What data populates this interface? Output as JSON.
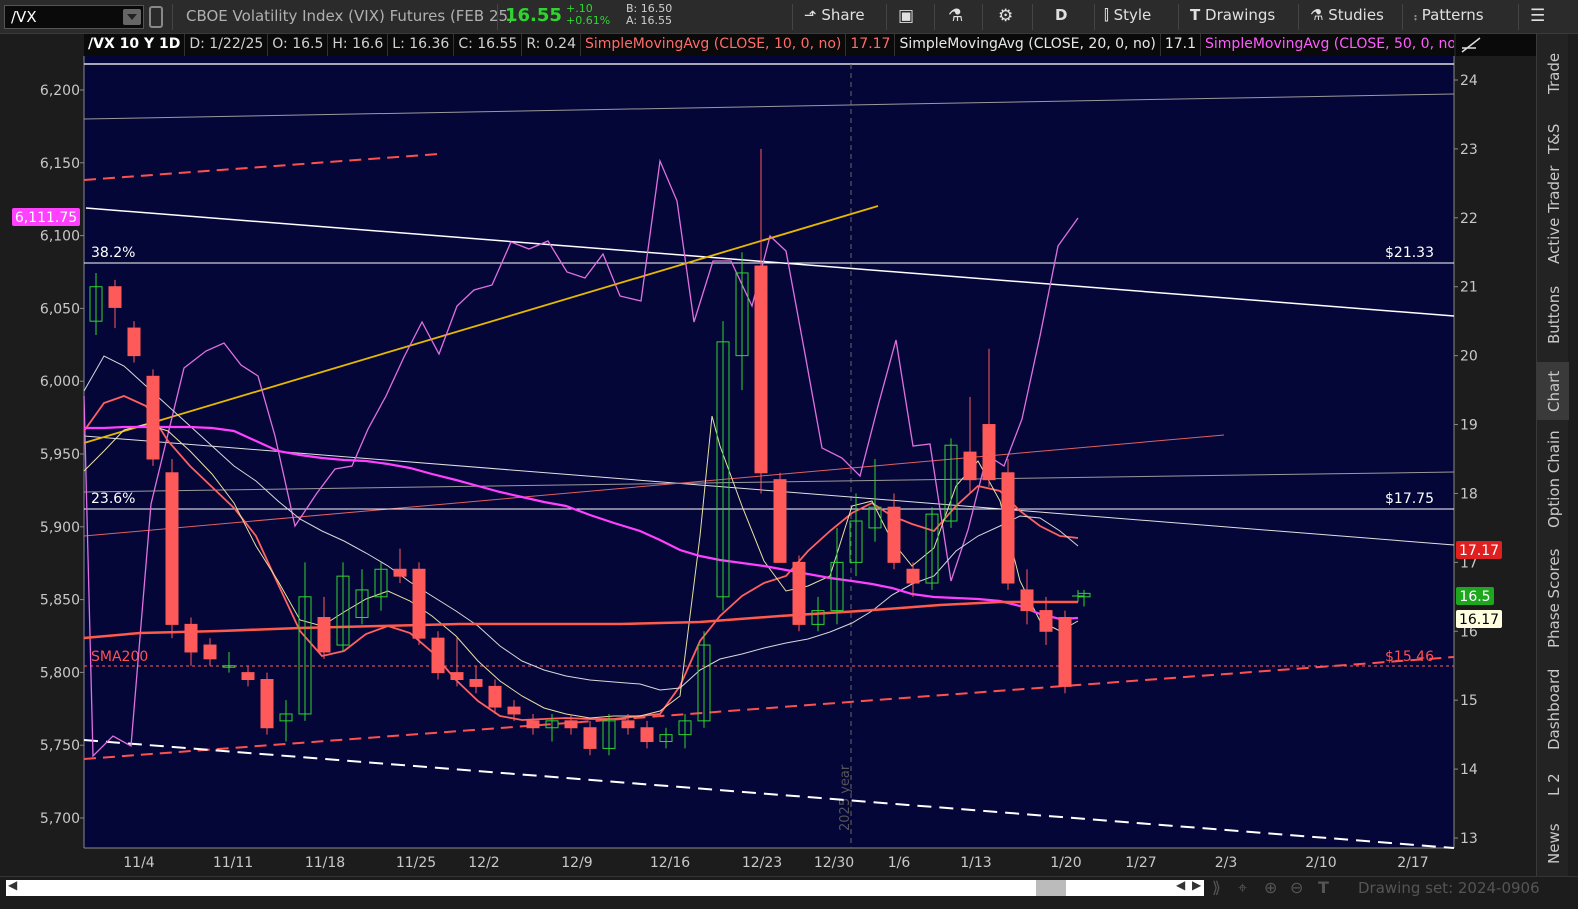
{
  "toolbar": {
    "symbol": "/VX",
    "description": "CBOE Volatility Index (VIX) Futures (FEB 25)",
    "last": "16.55",
    "change": "+.10",
    "change_pct": "+0.61%",
    "bid": "B: 16.50",
    "ask": "A: 16.55",
    "share_label": "Share",
    "aggregation": "D",
    "style_label": "Style",
    "drawings_label": "Drawings",
    "studies_label": "Studies",
    "patterns_label": "Patterns"
  },
  "header": {
    "symbol_period": "/VX 10 Y 1D",
    "date": "D: 1/22/25",
    "open": "O: 16.5",
    "high": "H: 16.6",
    "low": "L: 16.36",
    "close": "C: 16.55",
    "range": "R: 0.24",
    "sma10_label": "SimpleMovingAvg (CLOSE, 10, 0, no)",
    "sma10_value": "17.17",
    "sma20_label": "SimpleMovingAvg (CLOSE, 20, 0, no)",
    "sma20_value": "17.1",
    "sma50_label": "SimpleMovingAvg (CLOSE, 50, 0, no)",
    "more": "..."
  },
  "chart": {
    "left_axis_labels": [
      "6,200",
      "6,150",
      "6,100",
      "6,050",
      "6,000",
      "5,950",
      "5,900",
      "5,850",
      "5,800",
      "5,750",
      "5,700"
    ],
    "right_axis_labels": [
      "24",
      "23",
      "22",
      "21",
      "20",
      "19",
      "18",
      "17",
      "16",
      "15",
      "14",
      "13"
    ],
    "x_labels": [
      "11/4",
      "11/11",
      "11/18",
      "11/25",
      "12/2",
      "12/9",
      "12/16",
      "12/23",
      "12/30",
      "1/6",
      "1/13",
      "1/20",
      "1/27",
      "2/3",
      "2/10",
      "2/17"
    ],
    "left_price_tag": "6,111.75",
    "fib_382": "38.2%",
    "fib_236": "23.6%",
    "fib_382_value": "$21.33",
    "fib_236_value": "$17.75",
    "sma200_label": "SMA200",
    "sma200_value": "$15.46",
    "tag_sma10": "17.17",
    "tag_last": "16.5",
    "tag_sma50": "16.17",
    "year_label": "2025 year",
    "colors": {
      "background": "#050638",
      "up": "#2fd52f",
      "down": "#ff5a5a",
      "sma10": "#ff6060",
      "sma50": "#ff40ff",
      "spx": "#e070e0",
      "trend_yellow": "#e6b800"
    }
  },
  "candles": [
    {
      "d": "10/31",
      "o": 20.5,
      "h": 21.2,
      "l": 20.3,
      "c": 21.0
    },
    {
      "d": "11/1",
      "o": 21.0,
      "h": 21.1,
      "l": 20.4,
      "c": 20.7
    },
    {
      "d": "11/4",
      "o": 20.4,
      "h": 20.5,
      "l": 19.9,
      "c": 20.0
    },
    {
      "d": "11/5",
      "o": 19.7,
      "h": 19.8,
      "l": 18.4,
      "c": 18.5
    },
    {
      "d": "11/6",
      "o": 18.3,
      "h": 18.5,
      "l": 15.9,
      "c": 16.1
    },
    {
      "d": "11/7",
      "o": 16.1,
      "h": 16.2,
      "l": 15.5,
      "c": 15.7
    },
    {
      "d": "11/8",
      "o": 15.8,
      "h": 15.9,
      "l": 15.5,
      "c": 15.6
    },
    {
      "d": "11/11",
      "o": 15.5,
      "h": 15.7,
      "l": 15.4,
      "c": 15.5
    },
    {
      "d": "11/12",
      "o": 15.4,
      "h": 15.5,
      "l": 15.2,
      "c": 15.3
    },
    {
      "d": "11/13",
      "o": 15.3,
      "h": 15.4,
      "l": 14.5,
      "c": 14.6
    },
    {
      "d": "11/14",
      "o": 14.7,
      "h": 15.0,
      "l": 14.4,
      "c": 14.8
    },
    {
      "d": "11/15",
      "o": 14.8,
      "h": 17.0,
      "l": 14.7,
      "c": 16.5
    },
    {
      "d": "11/18",
      "o": 16.2,
      "h": 16.5,
      "l": 15.6,
      "c": 15.7
    },
    {
      "d": "11/19",
      "o": 15.8,
      "h": 17.0,
      "l": 15.7,
      "c": 16.8
    },
    {
      "d": "11/20",
      "o": 16.2,
      "h": 16.9,
      "l": 16.1,
      "c": 16.6
    },
    {
      "d": "11/21",
      "o": 16.5,
      "h": 17.0,
      "l": 16.3,
      "c": 16.9
    },
    {
      "d": "11/22",
      "o": 16.9,
      "h": 17.2,
      "l": 16.7,
      "c": 16.8
    },
    {
      "d": "11/25",
      "o": 16.9,
      "h": 17.0,
      "l": 15.8,
      "c": 15.9
    },
    {
      "d": "11/26",
      "o": 15.9,
      "h": 16.0,
      "l": 15.3,
      "c": 15.4
    },
    {
      "d": "11/27",
      "o": 15.4,
      "h": 15.9,
      "l": 15.2,
      "c": 15.3
    },
    {
      "d": "11/29",
      "o": 15.3,
      "h": 15.5,
      "l": 15.1,
      "c": 15.2
    },
    {
      "d": "12/2",
      "o": 15.2,
      "h": 15.3,
      "l": 14.8,
      "c": 14.9
    },
    {
      "d": "12/3",
      "o": 14.9,
      "h": 15.0,
      "l": 14.7,
      "c": 14.8
    },
    {
      "d": "12/4",
      "o": 14.7,
      "h": 14.8,
      "l": 14.5,
      "c": 14.6
    },
    {
      "d": "12/5",
      "o": 14.6,
      "h": 14.8,
      "l": 14.4,
      "c": 14.7
    },
    {
      "d": "12/6",
      "o": 14.7,
      "h": 14.8,
      "l": 14.5,
      "c": 14.6
    },
    {
      "d": "12/9",
      "o": 14.6,
      "h": 14.7,
      "l": 14.2,
      "c": 14.3
    },
    {
      "d": "12/10",
      "o": 14.3,
      "h": 14.8,
      "l": 14.2,
      "c": 14.7
    },
    {
      "d": "12/11",
      "o": 14.7,
      "h": 14.8,
      "l": 14.5,
      "c": 14.6
    },
    {
      "d": "12/12",
      "o": 14.6,
      "h": 14.7,
      "l": 14.3,
      "c": 14.4
    },
    {
      "d": "12/13",
      "o": 14.4,
      "h": 14.6,
      "l": 14.3,
      "c": 14.5
    },
    {
      "d": "12/16",
      "o": 14.5,
      "h": 14.8,
      "l": 14.3,
      "c": 14.7
    },
    {
      "d": "12/17",
      "o": 14.7,
      "h": 16.0,
      "l": 14.6,
      "c": 15.8
    },
    {
      "d": "12/18",
      "o": 16.5,
      "h": 20.5,
      "l": 16.3,
      "c": 20.2
    },
    {
      "d": "12/19",
      "o": 20.0,
      "h": 21.5,
      "l": 19.5,
      "c": 21.2
    },
    {
      "d": "12/20",
      "o": 21.3,
      "h": 23.0,
      "l": 18.0,
      "c": 18.3
    },
    {
      "d": "12/23",
      "o": 18.2,
      "h": 18.3,
      "l": 17.0,
      "c": 17.0
    },
    {
      "d": "12/24",
      "o": 17.0,
      "h": 17.1,
      "l": 16.0,
      "c": 16.1
    },
    {
      "d": "12/26",
      "o": 16.1,
      "h": 16.5,
      "l": 16.0,
      "c": 16.3
    },
    {
      "d": "12/27",
      "o": 16.3,
      "h": 17.5,
      "l": 16.1,
      "c": 17.0
    },
    {
      "d": "12/30",
      "o": 17.0,
      "h": 18.0,
      "l": 16.8,
      "c": 17.6
    },
    {
      "d": "12/31",
      "o": 17.5,
      "h": 18.5,
      "l": 17.3,
      "c": 17.8
    },
    {
      "d": "1/2",
      "o": 17.8,
      "h": 18.0,
      "l": 16.9,
      "c": 17.0
    },
    {
      "d": "1/3",
      "o": 16.9,
      "h": 17.0,
      "l": 16.5,
      "c": 16.7
    },
    {
      "d": "1/6",
      "o": 16.7,
      "h": 17.8,
      "l": 16.6,
      "c": 17.7
    },
    {
      "d": "1/7",
      "o": 17.6,
      "h": 18.8,
      "l": 17.5,
      "c": 18.7
    },
    {
      "d": "1/8",
      "o": 18.6,
      "h": 19.4,
      "l": 18.0,
      "c": 18.2
    },
    {
      "d": "1/10",
      "o": 19.0,
      "h": 20.1,
      "l": 18.1,
      "c": 18.2
    },
    {
      "d": "1/13",
      "o": 18.3,
      "h": 18.5,
      "l": 16.6,
      "c": 16.7
    },
    {
      "d": "1/14",
      "o": 16.6,
      "h": 16.9,
      "l": 16.1,
      "c": 16.3
    },
    {
      "d": "1/15",
      "o": 16.3,
      "h": 16.5,
      "l": 15.8,
      "c": 16.0
    },
    {
      "d": "1/21",
      "o": 16.2,
      "h": 16.3,
      "l": 15.1,
      "c": 15.2
    },
    {
      "d": "1/22",
      "o": 16.5,
      "h": 16.6,
      "l": 16.36,
      "c": 16.55
    }
  ]
}
